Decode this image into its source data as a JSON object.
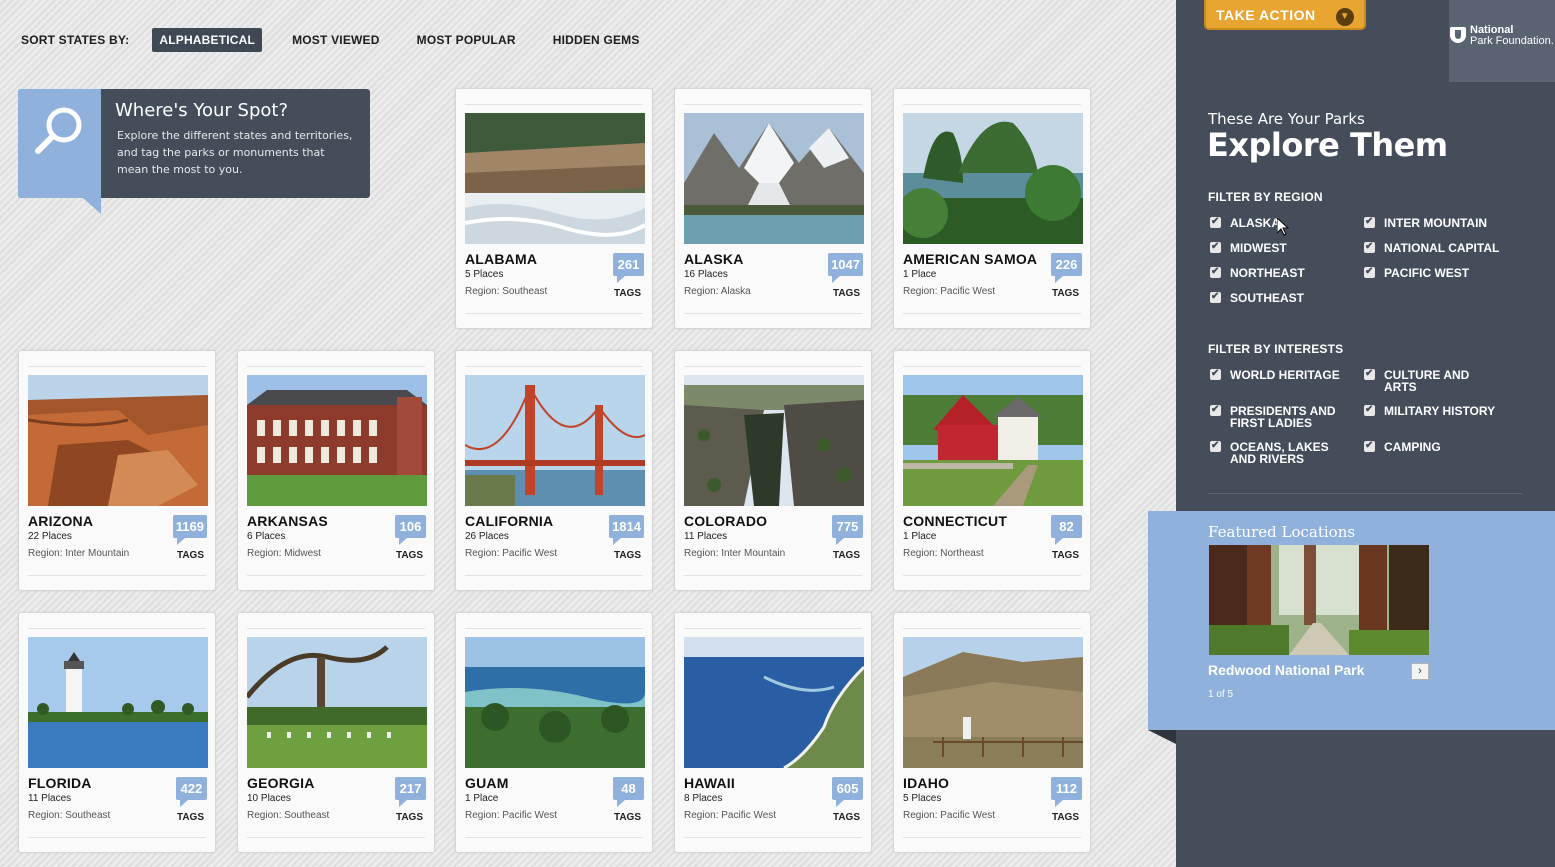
{
  "sort": {
    "label": "SORT STATES BY:",
    "options": [
      "ALPHABETICAL",
      "MOST VIEWED",
      "MOST POPULAR",
      "HIDDEN GEMS"
    ],
    "active": "ALPHABETICAL"
  },
  "info": {
    "title": "Where's Your Spot?",
    "text": "Explore the different states and territories, and tag the parks or monuments that mean the most to you."
  },
  "cards": [
    {
      "name": "ALABAMA",
      "places": "5 Places",
      "region": "Region: Southeast",
      "tags": "261",
      "tags_label": "TAGS",
      "photo": "waterfall"
    },
    {
      "name": "ALASKA",
      "places": "16 Places",
      "region": "Region: Alaska",
      "tags": "1047",
      "tags_label": "TAGS",
      "photo": "glacier"
    },
    {
      "name": "AMERICAN SAMOA",
      "places": "1 Place",
      "region": "Region: Pacific West",
      "tags": "226",
      "tags_label": "TAGS",
      "photo": "island"
    },
    {
      "name": "ARIZONA",
      "places": "22 Places",
      "region": "Region: Inter Mountain",
      "tags": "1169",
      "tags_label": "TAGS",
      "photo": "canyon"
    },
    {
      "name": "ARKANSAS",
      "places": "6 Places",
      "region": "Region: Midwest",
      "tags": "106",
      "tags_label": "TAGS",
      "photo": "building"
    },
    {
      "name": "CALIFORNIA",
      "places": "26 Places",
      "region": "Region: Pacific West",
      "tags": "1814",
      "tags_label": "TAGS",
      "photo": "bridge"
    },
    {
      "name": "COLORADO",
      "places": "11 Places",
      "region": "Region: Inter Mountain",
      "tags": "775",
      "tags_label": "TAGS",
      "photo": "gorge"
    },
    {
      "name": "CONNECTICUT",
      "places": "1 Place",
      "region": "Region: Northeast",
      "tags": "82",
      "tags_label": "TAGS",
      "photo": "house"
    },
    {
      "name": "FLORIDA",
      "places": "11 Places",
      "region": "Region: Southeast",
      "tags": "422",
      "tags_label": "TAGS",
      "photo": "lighthouse"
    },
    {
      "name": "GEORGIA",
      "places": "10 Places",
      "region": "Region: Southeast",
      "tags": "217",
      "tags_label": "TAGS",
      "photo": "cemetery"
    },
    {
      "name": "GUAM",
      "places": "1 Place",
      "region": "Region: Pacific West",
      "tags": "48",
      "tags_label": "TAGS",
      "photo": "coast"
    },
    {
      "name": "HAWAII",
      "places": "8 Places",
      "region": "Region: Pacific West",
      "tags": "605",
      "tags_label": "TAGS",
      "photo": "shore"
    },
    {
      "name": "IDAHO",
      "places": "5 Places",
      "region": "Region: Pacific West",
      "tags": "112",
      "tags_label": "TAGS",
      "photo": "hills"
    }
  ],
  "right": {
    "take_action": "TAKE ACTION",
    "logo_line1": "National",
    "logo_line2": "Park Foundation.",
    "subtitle": "These Are Your Parks",
    "title": "Explore Them",
    "region_heading": "FILTER BY REGION",
    "regions": [
      "ALASKA",
      "INTER MOUNTAIN",
      "MIDWEST",
      "NATIONAL CAPITAL",
      "NORTHEAST",
      "PACIFIC WEST",
      "SOUTHEAST"
    ],
    "interests_heading": "FILTER BY INTERESTS",
    "interests": [
      "WORLD HERITAGE",
      "CULTURE AND ARTS",
      "PRESIDENTS AND FIRST LADIES",
      "MILITARY HISTORY",
      "OCEANS, LAKES AND RIVERS",
      "CAMPING"
    ],
    "featured_heading": "Featured Locations",
    "featured_name": "Redwood National Park",
    "featured_next": "›",
    "featured_count": "1 of 5"
  },
  "icons": {
    "search": "search-icon",
    "take_action": "chevron-down-icon",
    "checkbox": "check-icon"
  },
  "colors": {
    "accent": "#8fb1dc",
    "panel": "#444d59",
    "cta": "#e9a531"
  }
}
